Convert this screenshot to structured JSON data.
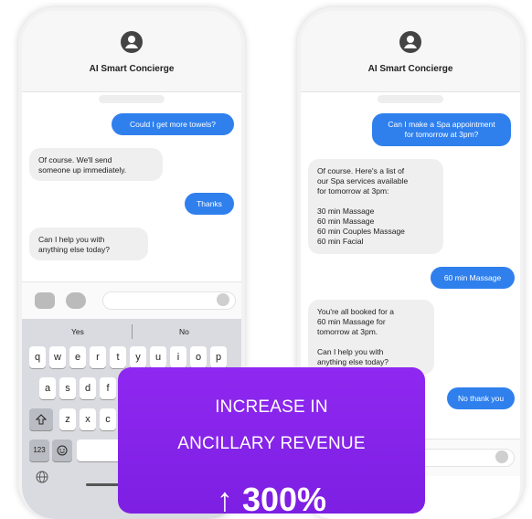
{
  "left_phone": {
    "header_title": "AI Smart Concierge",
    "messages": [
      {
        "from": "guest",
        "text": "Could I get more towels?"
      },
      {
        "from": "bot",
        "text": "Of course. We'll send\nsomeone up immediately."
      },
      {
        "from": "guest",
        "text": "Thanks"
      },
      {
        "from": "bot",
        "text": "Can I help you with\nanything else today?"
      }
    ],
    "suggestions": [
      "Yes",
      "No"
    ],
    "keyboard": {
      "row1": [
        "q",
        "w",
        "e",
        "r",
        "t",
        "y",
        "u",
        "i",
        "o",
        "p"
      ],
      "row2": [
        "a",
        "s",
        "d",
        "f"
      ],
      "row3": [
        "z",
        "x",
        "c"
      ],
      "numbers_key": "123"
    }
  },
  "right_phone": {
    "header_title": "AI Smart Concierge",
    "messages": [
      {
        "from": "guest",
        "text": "Can I make a Spa appointment\nfor tomorrow at 3pm?"
      },
      {
        "from": "bot",
        "text": "Of course. Here's a list of\nour Spa services available\nfor tomorrow at 3pm:\n\n30 min Massage\n60 min Massage\n60 min Couples Massage\n60 min Facial"
      },
      {
        "from": "guest",
        "text": "60 min Massage"
      },
      {
        "from": "bot",
        "text": "You're all booked for a\n60 min Massage for\ntomorrow at 3pm.\n\nCan I help you with\nanything else today?"
      },
      {
        "from": "guest",
        "text": "No thank you"
      }
    ]
  },
  "banner": {
    "line1": "INCREASE IN",
    "line2": "ANCILLARY REVENUE",
    "value": "↑ 300%"
  },
  "colors": {
    "accent_blue": "#2f80ed",
    "banner_purple": "#8a2be2"
  },
  "icons": [
    "user-avatar-icon",
    "camera-icon",
    "appstore-icon",
    "send-arrow-icon",
    "shift-icon",
    "emoji-icon",
    "globe-icon"
  ]
}
